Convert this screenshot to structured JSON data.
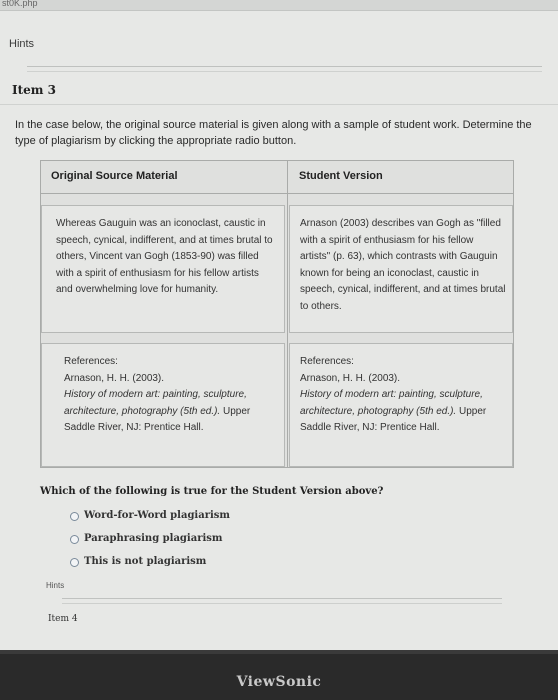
{
  "browser": {
    "file_label": "st0K.php"
  },
  "hints_top": {
    "label": "Hints"
  },
  "item": {
    "label": "Item 3",
    "instructions": "In the case below, the original source material is given along with a sample of student work. Determine the type of plagiarism by clicking the appropriate radio button."
  },
  "table": {
    "col_original": "Original Source Material",
    "col_student": "Student Version",
    "original_text": "Whereas Gauguin was an iconoclast, caustic in speech, cynical, indifferent, and at times brutal to others, Vincent van Gogh (1853-90) was filled with a spirit of enthusiasm for his fellow artists and overwhelming love for humanity.",
    "student_text": "Arnason (2003) describes van Gogh as \"filled with a spirit of enthusiasm for his fellow artists\" (p. 63), which contrasts with Gauguin known for being an iconoclast, caustic in speech, cynical, indifferent, and at times brutal to others.",
    "references_label": "References:",
    "ref_author": "Arnason, H. H. (2003).",
    "ref_book": "History of modern art: painting, sculpture, architecture, photography (5th ed.).",
    "ref_publisher": "Upper Saddle River, NJ: Prentice Hall."
  },
  "question": {
    "text": "Which of the following is true for the Student Version above?",
    "options": [
      "Word-for-Word plagiarism",
      "Paraphrasing plagiarism",
      "This is not plagiarism"
    ]
  },
  "hints_bottom": {
    "label": "Hints"
  },
  "next_item": {
    "label": "Item 4"
  },
  "monitor": {
    "brand": "ViewSonic"
  }
}
